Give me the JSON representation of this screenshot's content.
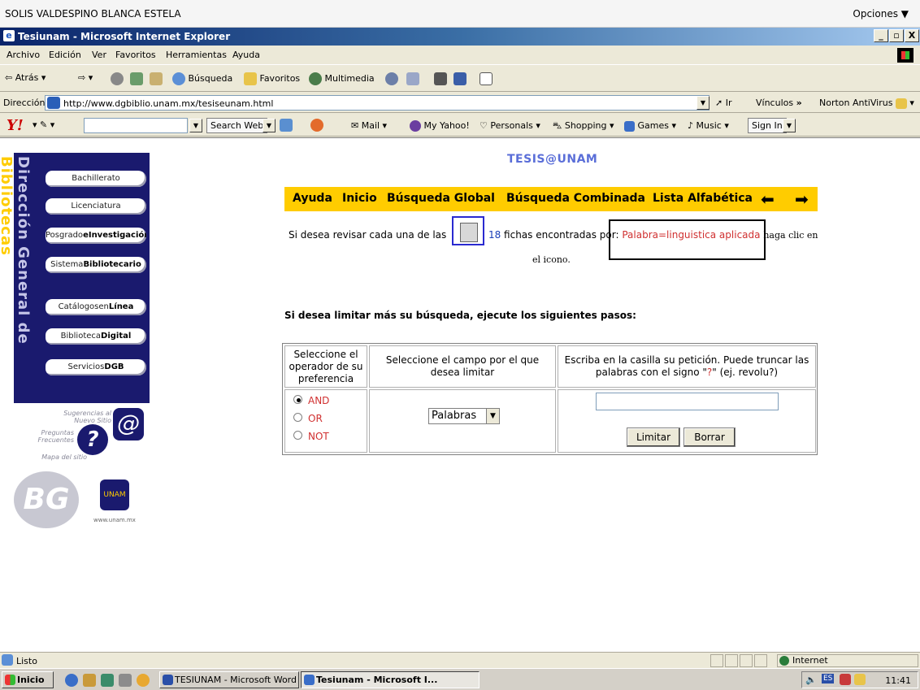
{
  "userbar": {
    "username": "SOLIS VALDESPINO BLANCA ESTELA",
    "options": "Opciones ▼"
  },
  "window": {
    "title": "Tesiunam - Microsoft Internet Explorer",
    "min": "_",
    "max": "🗗",
    "close": "X"
  },
  "menu": [
    "Archivo",
    "Edición",
    "Ver",
    "Favoritos",
    "Herramientas",
    "Ayuda"
  ],
  "toolbar": {
    "back": "Atrás",
    "search": "Búsqueda",
    "favorites": "Favoritos",
    "multimedia": "Multimedia"
  },
  "address": {
    "label": "Dirección",
    "url": "http://www.dgbiblio.unam.mx/tesiseunam.html",
    "go": "Ir",
    "links": "Vínculos",
    "norton": "Norton AntiVirus"
  },
  "yahoo": {
    "logo": "Y!",
    "search_value": "",
    "search_web": "Search Web",
    "mail": "Mail",
    "my_yahoo": "My Yahoo!",
    "personals": "Personals",
    "shopping": "Shopping",
    "games": "Games",
    "music": "Music",
    "sign_in": "Sign In"
  },
  "sidebar": {
    "vertical_text_a": "Dirección General de ",
    "vertical_text_b": "Bibliotecas",
    "items": [
      {
        "pre": "Bachillerato",
        "bold": ""
      },
      {
        "pre": "Licenciatura",
        "bold": ""
      },
      {
        "pre": "Posgrado",
        "bold": "eInvestigación"
      },
      {
        "pre": "Sistema",
        "bold": "Bibliotecario"
      },
      {
        "pre": "Catálogosen",
        "bold": "Línea"
      },
      {
        "pre": "Biblioteca",
        "bold": "Digital"
      },
      {
        "pre": "Servicios",
        "bold": "DGB"
      }
    ],
    "sugerencias": "Sugerencias al Nuevo Sitio",
    "preguntas": "Preguntas Frecuentes",
    "mapa": "Mapa del sitio",
    "unam_url": "www.unam.mx"
  },
  "page": {
    "site_title": "TESIS@UNAM",
    "nav": [
      "Ayuda",
      "Inicio",
      "Búsqueda Global",
      "Búsqueda Combinada",
      "Lista Alfabética"
    ],
    "result_pre": "Si desea revisar cada una de las",
    "result_count": "18",
    "result_mid": "fichas encontradas por:",
    "result_query": "Palabra=linguistica aplicada",
    "result_post": "haga clic en",
    "result_post2": "el icono.",
    "limit_heading": "Si desea limitar más su búsqueda, ejecute los siguientes pasos:",
    "table": {
      "col1_header": "Seleccione el operador de su preferencia",
      "col2_header": "Seleccione el campo por el que desea limitar",
      "col3_header_a": "Escriba en la casilla su petición. Puede truncar las palabras con el signo \"",
      "col3_header_q": "?",
      "col3_header_b": "\" (ej. revolu?)",
      "operators": [
        "AND",
        "OR",
        "NOT"
      ],
      "selected_operator": "AND",
      "field_value": "Palabras",
      "query_value": "",
      "limit_button": "Limitar",
      "clear_button": "Borrar"
    }
  },
  "status": {
    "text": "Listo",
    "zone": "Internet"
  },
  "taskbar": {
    "start": "Inicio",
    "task1": "TESIUNAM - Microsoft Word",
    "task2": "Tesiunam - Microsoft I...",
    "lang": "ES",
    "clock": "11:41"
  }
}
